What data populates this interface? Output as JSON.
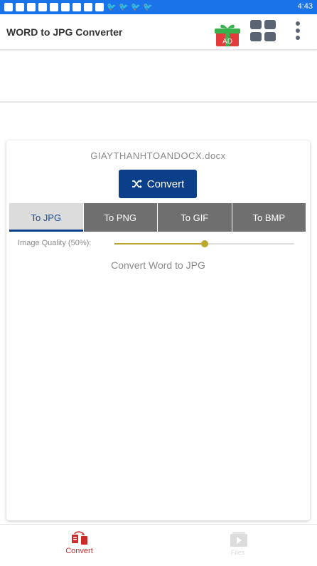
{
  "status_bar": {
    "time": "4:43",
    "icons": [
      "app-icon",
      "app-icon",
      "app-icon",
      "app-icon",
      "app-icon",
      "app-icon",
      "app-icon",
      "facebook-icon",
      "app-icon",
      "twitter-icon",
      "twitter-icon",
      "twitter-icon",
      "twitter-icon"
    ]
  },
  "app_bar": {
    "title": "WORD to JPG Converter",
    "ad_label": "AD"
  },
  "file": {
    "name": "GIAYTHANHTOANDOCX.docx"
  },
  "convert_button": {
    "label": "Convert"
  },
  "tabs": [
    {
      "label": "To JPG",
      "active": true
    },
    {
      "label": "To PNG",
      "active": false
    },
    {
      "label": "To GIF",
      "active": false
    },
    {
      "label": "To BMP",
      "active": false
    }
  ],
  "quality": {
    "label": "Image Quality (50%):",
    "value_percent": 50
  },
  "section_title": "Convert Word to JPG",
  "bottom_nav": [
    {
      "label": "Convert",
      "active": true
    },
    {
      "label": "Files",
      "active": false
    }
  ],
  "colors": {
    "status_bar": "#1a73e8",
    "primary": "#0b3f8a",
    "tab_inactive": "#6f6f6f",
    "accent_slider": "#b8a82e",
    "nav_active": "#cc2a2a"
  }
}
